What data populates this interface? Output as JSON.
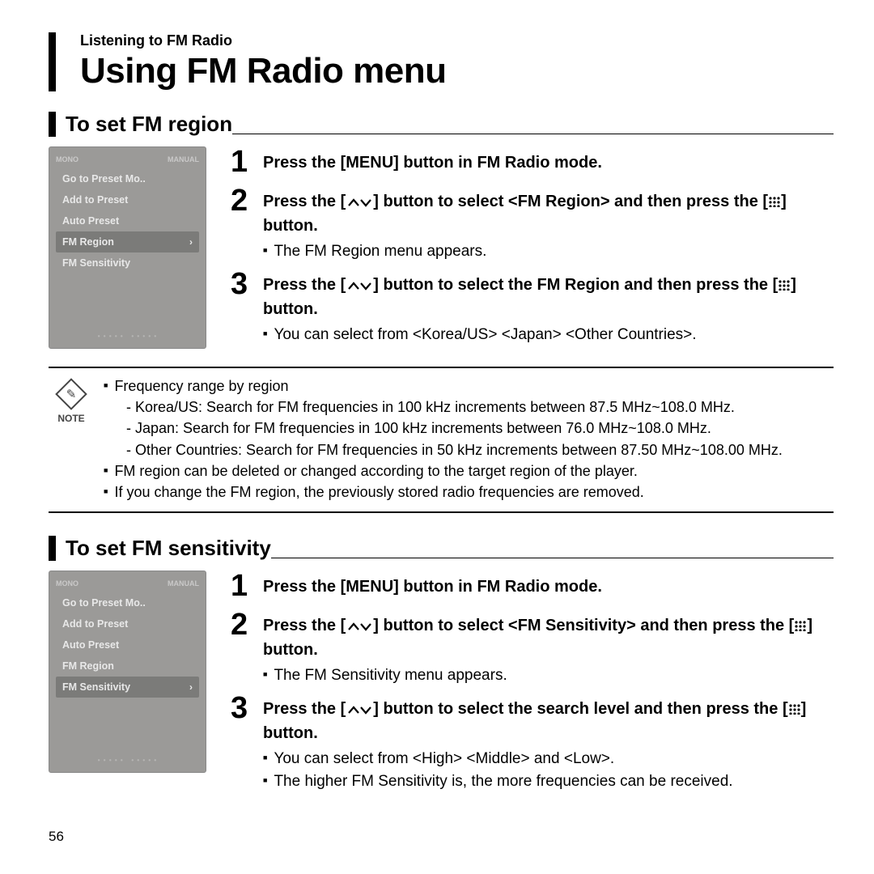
{
  "header": {
    "breadcrumb": "Listening to FM Radio",
    "title": "Using FM Radio menu"
  },
  "page_number": "56",
  "section_a": {
    "heading": "To set FM region",
    "device_menu": {
      "top_left": "MONO",
      "top_right": "MANUAL",
      "items": [
        "Go to Preset Mo..",
        "Add to Preset",
        "Auto Preset",
        "FM Region",
        "FM Sensitivity"
      ],
      "selected_index": 3
    },
    "steps": [
      {
        "num": "1",
        "bold_a": "Press the [MENU] button in FM Radio mode."
      },
      {
        "num": "2",
        "bold_a": "Press the [",
        "bold_b": "] button to select <FM Region> and then press the [",
        "bold_c": "] button.",
        "sub": "The FM Region menu appears."
      },
      {
        "num": "3",
        "bold_a": "Press the [",
        "bold_b": "] button to select the FM Region and then press the [",
        "bold_c": "] button.",
        "sub": "You can select from <Korea/US> <Japan> <Other Countries>."
      }
    ]
  },
  "note": {
    "label": "NOTE",
    "line1": "Frequency range by region",
    "line2": "- Korea/US: Search for FM frequencies in 100 kHz increments between 87.5 MHz~108.0 MHz.",
    "line3": "- Japan: Search for FM frequencies in 100 kHz increments between 76.0 MHz~108.0 MHz.",
    "line4": "- Other Countries: Search for FM frequencies in 50 kHz increments between 87.50 MHz~108.00 MHz.",
    "line5": "FM region can be deleted or changed according to the target region of the player.",
    "line6": "If you change the FM region, the previously stored radio frequencies are removed."
  },
  "section_b": {
    "heading": "To set FM sensitivity",
    "device_menu": {
      "top_left": "MONO",
      "top_right": "MANUAL",
      "items": [
        "Go to Preset Mo..",
        "Add to Preset",
        "Auto Preset",
        "FM Region",
        "FM Sensitivity"
      ],
      "selected_index": 4
    },
    "steps": [
      {
        "num": "1",
        "bold_a": "Press the [MENU] button in FM Radio mode."
      },
      {
        "num": "2",
        "bold_a": "Press the [",
        "bold_b": "] button to select <FM Sensitivity> and then press the [",
        "bold_c": "] button.",
        "sub": "The FM Sensitivity menu appears."
      },
      {
        "num": "3",
        "bold_a": "Press the [",
        "bold_b": "] button to select the search level and then press the [",
        "bold_c": "] button.",
        "sub": "You can select from <High> <Middle> and <Low>.",
        "sub2": "The higher FM Sensitivity is, the more frequencies can be received."
      }
    ]
  }
}
